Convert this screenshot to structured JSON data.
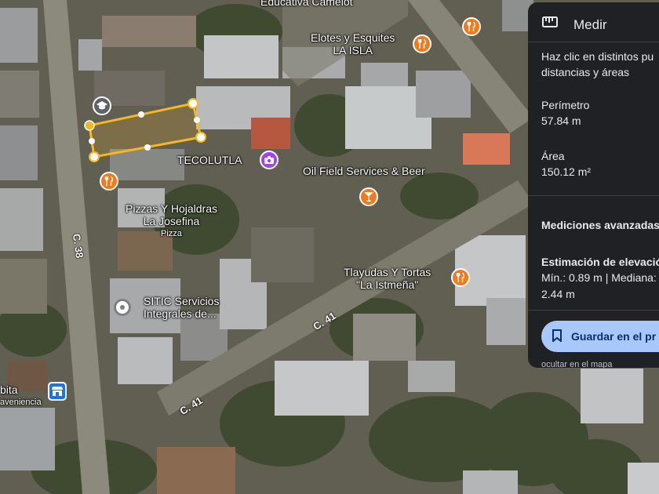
{
  "map": {
    "places": {
      "school_top": "Educativa Camelot",
      "elotes_line1": "Elotes y Esquites",
      "elotes_line2": "LA ISLA",
      "tecolutla": "TECOLUTLA",
      "oil_field": "Oil Field Services & Beer",
      "pizzas_line1": "Pizzas Y Hojaldras",
      "pizzas_line2": "La Josefina",
      "pizzas_category": "Pizza",
      "sitic_line1": "SITIC Servicios",
      "sitic_line2": "Integrales de...",
      "tlayudas_line1": "Tlayudas Y Tortas",
      "tlayudas_line2": "\"La Istmeña\"",
      "store_line1": "bita",
      "store_line2": "aveniencia"
    },
    "roads": {
      "c38": "C. 38",
      "c41_a": "C. 41",
      "c41_b": "C. 41"
    },
    "icons": {
      "school": "school-icon",
      "restaurant": "restaurant-icon",
      "photo": "camera-icon",
      "bar": "cocktail-icon",
      "place": "place-pin-icon",
      "store": "store-icon"
    }
  },
  "panel": {
    "title": "Medir",
    "instructions_line1": "Haz clic en distintos pu",
    "instructions_line2": "distancias y áreas",
    "perimeter_label": "Perímetro",
    "perimeter_value": "57.84 m",
    "area_label": "Área",
    "area_value": "150.12 m²",
    "advanced_label": "Mediciones avanzadas",
    "elevation_label": "Estimación de elevació",
    "elevation_line1": "Mín.: 0.89 m | Mediana:",
    "elevation_line2": "2.44 m",
    "save_label": "Guardar en el pr",
    "bottom_partial": "ocultar en el mapa"
  },
  "colors": {
    "measure_line": "#f5b823",
    "panel_bg": "#202124",
    "save_button": "#a8c7fa",
    "pin_orange": "#f07b1e",
    "pin_purple": "#a142f4"
  }
}
